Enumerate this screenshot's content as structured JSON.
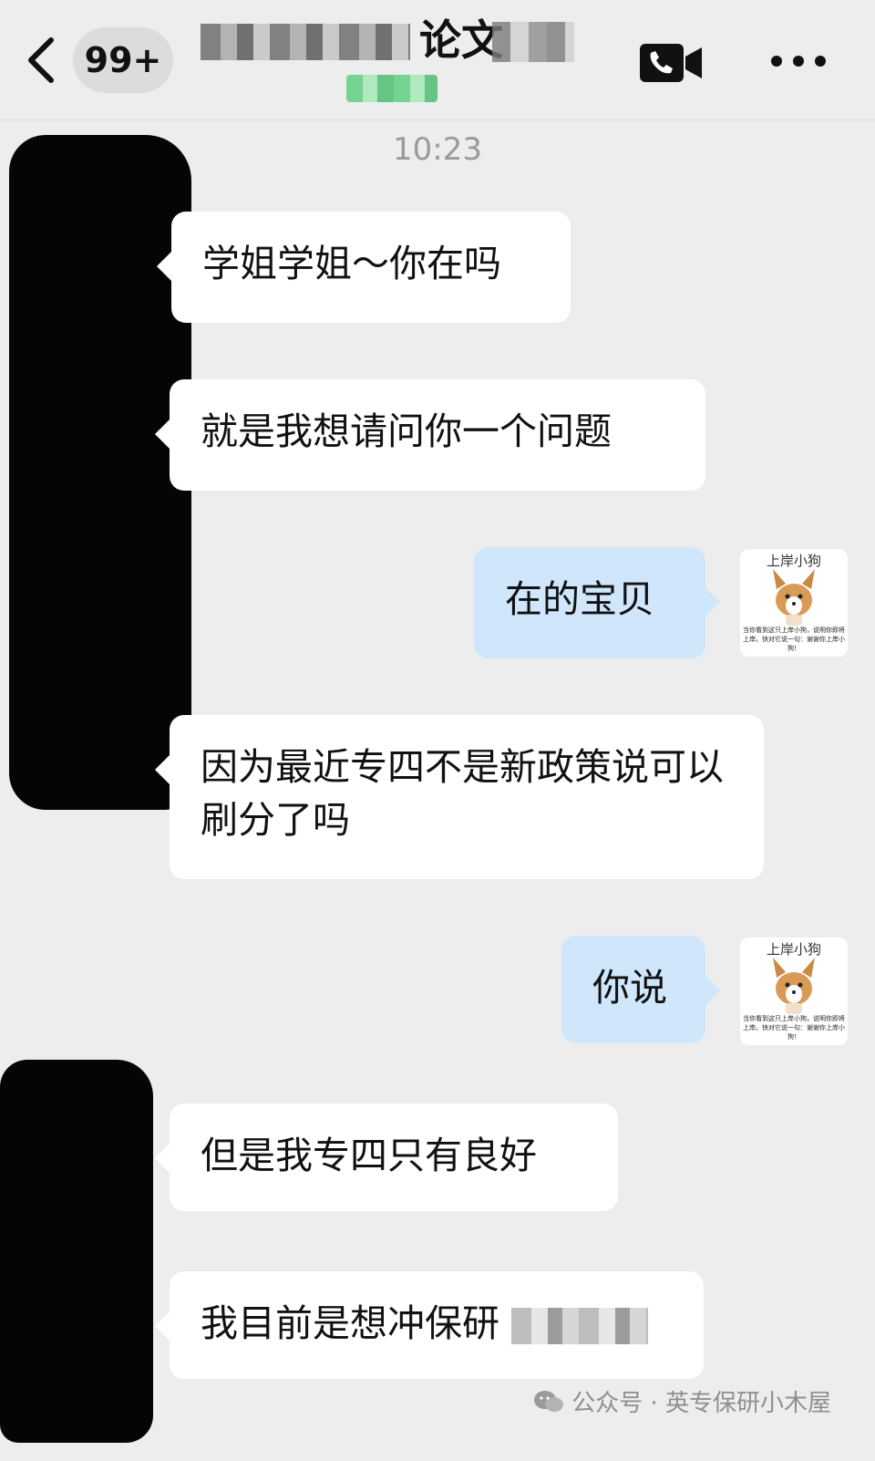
{
  "header": {
    "unread_count": "99+",
    "title_visible_text": "论文",
    "colors": {
      "background": "#ededed",
      "text": "#111111"
    },
    "icons": {
      "back": "chevron-left-icon",
      "video_call": "video-call-icon",
      "more": "more-dots-icon"
    }
  },
  "chat": {
    "timestamp": "10:23",
    "messages": [
      {
        "side": "in",
        "text": "学姐学姐～你在吗"
      },
      {
        "side": "in",
        "text": "就是我想请问你一个问题"
      },
      {
        "side": "out",
        "text": "在的宝贝"
      },
      {
        "side": "in",
        "text": "因为最近专四不是新政策说可以刷分了吗"
      },
      {
        "side": "out",
        "text": "你说"
      },
      {
        "side": "in",
        "text": "但是我专四只有良好"
      },
      {
        "side": "in",
        "text": "我目前是想冲保研"
      }
    ],
    "colors": {
      "incoming_bubble": "#ffffff",
      "outgoing_bubble": "#cfe6fb"
    }
  },
  "self_avatar": {
    "title": "上岸小狗",
    "caption": "当你看到这只上岸小狗，说明你即将上岸。快对它说一句：谢谢你上岸小狗！"
  },
  "watermark": {
    "text": "公众号 · 英专保研小木屋",
    "icon": "wechat-icon"
  }
}
